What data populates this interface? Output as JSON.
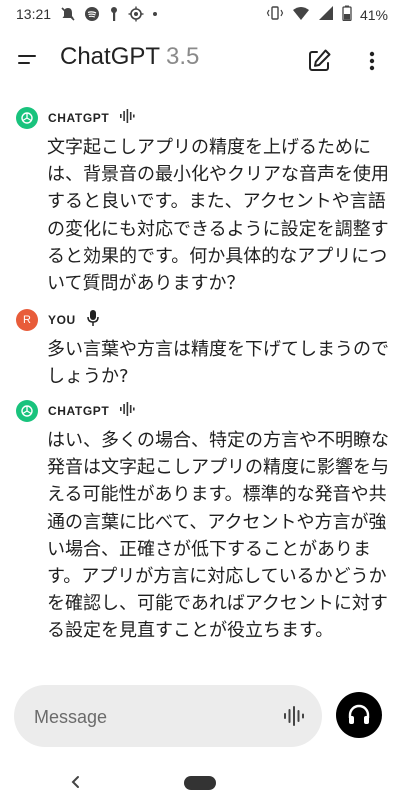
{
  "status_bar": {
    "time": "13:21",
    "battery_percent": "41%",
    "icons_left": [
      "mute-icon",
      "spotify-icon",
      "key-icon",
      "location-icon",
      "dot-icon"
    ],
    "icons_right": [
      "vibrate-icon",
      "wifi-icon",
      "signal-icon",
      "battery-icon"
    ]
  },
  "app_bar": {
    "title": "ChatGPT",
    "model": "3.5"
  },
  "messages": [
    {
      "sender": "CHATGPT",
      "role": "assistant",
      "text": "文字起こしアプリの精度を上げるためには、背景音の最小化やクリアな音声を使用すると良いです。また、アクセントや言語の変化にも対応できるように設定を調整すると効果的です。何か具体的なアプリについて質問がありますか？"
    },
    {
      "sender": "YOU",
      "avatar_initial": "R",
      "role": "user",
      "text": "多い言葉や方言は精度を下げてしまうのでしょうか?"
    },
    {
      "sender": "CHATGPT",
      "role": "assistant",
      "text": "はい、多くの場合、特定の方言や不明瞭な発音は文字起こしアプリの精度に影響を与える可能性があります。標準的な発音や共通の言葉に比べて、アクセントや方言が強い場合、正確さが低下することがあります。アプリが方言に対応しているかどうかを確認し、可能であればアクセントに対する設定を見直すことが役立ちます。"
    }
  ],
  "composer": {
    "placeholder": "Message"
  },
  "colors": {
    "gpt_avatar": "#19c37d",
    "user_avatar": "#e85c3a",
    "composer_bg": "#ececec"
  }
}
